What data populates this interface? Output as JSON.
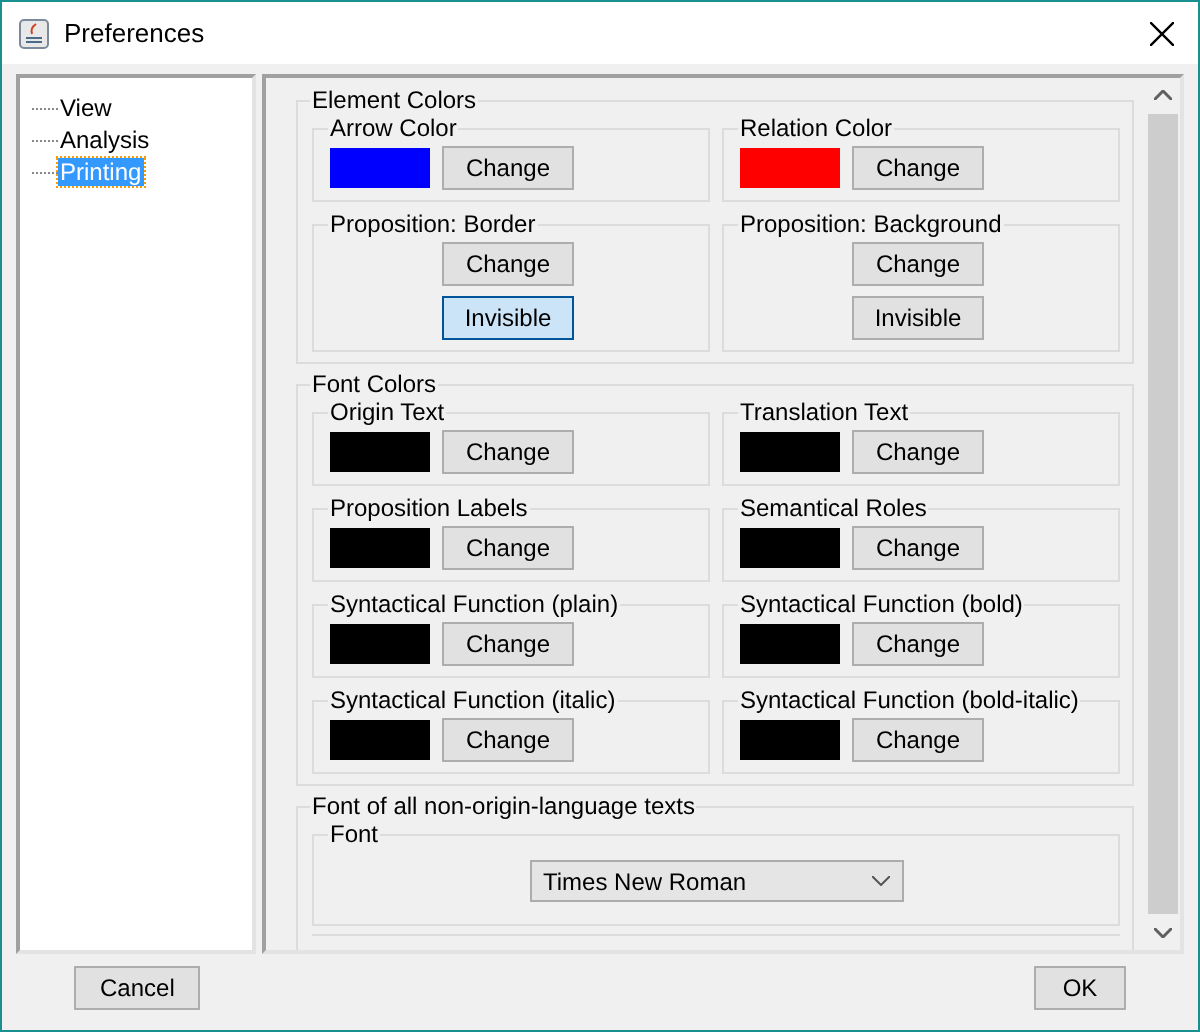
{
  "window": {
    "title": "Preferences"
  },
  "tree": {
    "items": [
      {
        "label": "View",
        "selected": false
      },
      {
        "label": "Analysis",
        "selected": false
      },
      {
        "label": "Printing",
        "selected": true
      }
    ]
  },
  "element_colors": {
    "title": "Element Colors",
    "groups": [
      {
        "kind": "swatch",
        "title": "Arrow Color",
        "color": "#0000ff",
        "buttons": [
          {
            "label": "Change",
            "focused": false
          }
        ]
      },
      {
        "kind": "swatch",
        "title": "Relation Color",
        "color": "#ff0000",
        "buttons": [
          {
            "label": "Change",
            "focused": false
          }
        ]
      },
      {
        "kind": "buttons",
        "title": "Proposition: Border",
        "buttons": [
          {
            "label": "Change",
            "focused": false
          },
          {
            "label": "Invisible",
            "focused": true
          }
        ]
      },
      {
        "kind": "buttons",
        "title": "Proposition: Background",
        "buttons": [
          {
            "label": "Change",
            "focused": false
          },
          {
            "label": "Invisible",
            "focused": false
          }
        ]
      }
    ]
  },
  "font_colors": {
    "title": "Font Colors",
    "groups": [
      {
        "kind": "swatch",
        "title": "Origin Text",
        "color": "#000000",
        "buttons": [
          {
            "label": "Change",
            "focused": false
          }
        ]
      },
      {
        "kind": "swatch",
        "title": "Translation Text",
        "color": "#000000",
        "buttons": [
          {
            "label": "Change",
            "focused": false
          }
        ]
      },
      {
        "kind": "swatch",
        "title": "Proposition Labels",
        "color": "#000000",
        "buttons": [
          {
            "label": "Change",
            "focused": false
          }
        ]
      },
      {
        "kind": "swatch",
        "title": "Semantical Roles",
        "color": "#000000",
        "buttons": [
          {
            "label": "Change",
            "focused": false
          }
        ]
      },
      {
        "kind": "swatch",
        "title": "Syntactical Function (plain)",
        "color": "#000000",
        "buttons": [
          {
            "label": "Change",
            "focused": false
          }
        ]
      },
      {
        "kind": "swatch",
        "title": "Syntactical Function (bold)",
        "color": "#000000",
        "buttons": [
          {
            "label": "Change",
            "focused": false
          }
        ]
      },
      {
        "kind": "swatch",
        "title": "Syntactical Function (italic)",
        "color": "#000000",
        "buttons": [
          {
            "label": "Change",
            "focused": false
          }
        ]
      },
      {
        "kind": "swatch",
        "title": "Syntactical Function (bold-italic)",
        "color": "#000000",
        "buttons": [
          {
            "label": "Change",
            "focused": false
          }
        ]
      }
    ]
  },
  "font_section": {
    "title": "Font of all non-origin-language texts",
    "font_group": {
      "title": "Font",
      "value": "Times New Roman"
    }
  },
  "buttons": [
    {
      "label": "Cancel"
    },
    {
      "label": "OK"
    }
  ]
}
